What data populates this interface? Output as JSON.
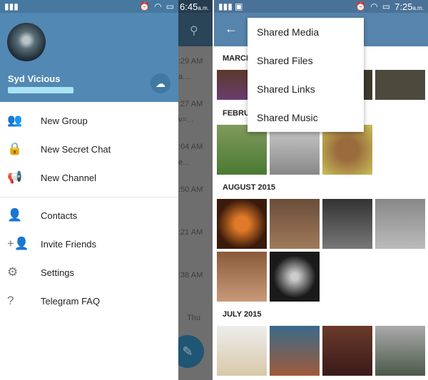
{
  "left_screen": {
    "status": {
      "time": "6:45",
      "ampm": "a.m."
    },
    "user": {
      "name": "Syd Vicious"
    },
    "menu": [
      {
        "label": "New Group",
        "icon": "group-icon"
      },
      {
        "label": "New Secret Chat",
        "icon": "lock-icon"
      },
      {
        "label": "New Channel",
        "icon": "megaphone-icon"
      },
      {
        "label": "Contacts",
        "icon": "contacts-icon"
      },
      {
        "label": "Invite Friends",
        "icon": "person-add-icon"
      },
      {
        "label": "Settings",
        "icon": "gear-icon"
      },
      {
        "label": "Telegram FAQ",
        "icon": "help-icon"
      }
    ],
    "chat_times": [
      ":29 AM",
      ":27 AM",
      ":04 AM",
      ":50 AM",
      ":21 AM",
      ":38 AM",
      "Thu"
    ],
    "chat_snippets": [
      "a....",
      "v=...",
      "e..."
    ]
  },
  "right_screen": {
    "status": {
      "time": "7:25",
      "ampm": "a.m."
    },
    "dropdown": [
      "Shared Media",
      "Shared Files",
      "Shared Links",
      "Shared Music"
    ],
    "sections": [
      "MARCH",
      "FEBRU",
      "AUGUST 2015",
      "JULY 2015"
    ]
  },
  "colors": {
    "header": "#5288b4",
    "right_header": "#5684ab",
    "fab": "#1f5673"
  }
}
